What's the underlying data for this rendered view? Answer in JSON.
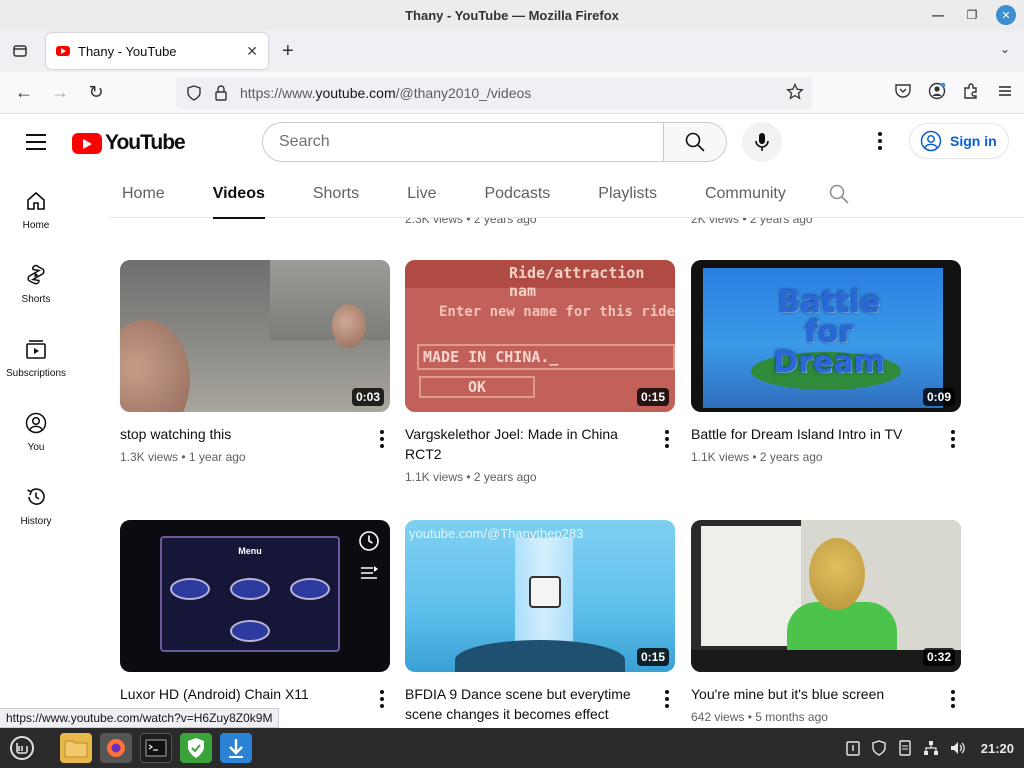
{
  "window": {
    "title": "Thany - YouTube — Mozilla Firefox"
  },
  "browser": {
    "tab_title": "Thany - YouTube",
    "url_prefix": "https://www.",
    "url_domain": "youtube.com",
    "url_path": "/@thany2010_/videos",
    "status_link": "https://www.youtube.com/watch?v=H6Zuy8Z0k9M"
  },
  "yt": {
    "logo_text": "YouTube",
    "search_placeholder": "Search",
    "sign_in": "Sign in"
  },
  "rail": [
    {
      "label": "Home",
      "icon": "home-icon"
    },
    {
      "label": "Shorts",
      "icon": "shorts-icon"
    },
    {
      "label": "Subscriptions",
      "icon": "subscriptions-icon"
    },
    {
      "label": "You",
      "icon": "you-icon"
    },
    {
      "label": "History",
      "icon": "history-icon"
    }
  ],
  "channel_tabs": [
    "Home",
    "Videos",
    "Shorts",
    "Live",
    "Podcasts",
    "Playlists",
    "Community"
  ],
  "active_tab": "Videos",
  "stub_row": [
    {
      "meta": "2.3K views • 2 years ago"
    },
    {
      "meta": "2K views • 2 years ago"
    }
  ],
  "videos": [
    {
      "title": "stop watching this",
      "meta": "1.3K views • 1 year ago",
      "duration": "0:03"
    },
    {
      "title": "Vargskelethor Joel: Made in China RCT2",
      "meta": "1.1K views • 2 years ago",
      "duration": "0:15",
      "thumb_text": {
        "header": "Ride/attraction nam",
        "prompt": "Enter new name for this ride",
        "input": "MADE IN CHINA._",
        "ok": "OK"
      }
    },
    {
      "title": "Battle for Dream Island Intro in TV",
      "meta": "1.1K views • 2 years ago",
      "duration": "0:09",
      "thumb_text": {
        "logo": "Battle for Dream"
      }
    },
    {
      "title": "Luxor HD (Android) Chain X11",
      "meta": "",
      "duration": "",
      "thumb_text": {
        "menu": "Menu"
      }
    },
    {
      "title": "BFDIA 9 Dance scene but everytime scene changes it becomes effect",
      "meta": "",
      "duration": "0:15",
      "thumb_text": {
        "watermark": "youtube.com/@Thanythep283"
      }
    },
    {
      "title": "You're mine but it's blue screen",
      "meta": "642 views • 5 months ago",
      "duration": "0:32"
    }
  ],
  "taskbar": {
    "clock": "21:20"
  },
  "colors": {
    "yt_red": "#ff0000",
    "link_blue": "#065fd4",
    "meta_gray": "#606060"
  }
}
